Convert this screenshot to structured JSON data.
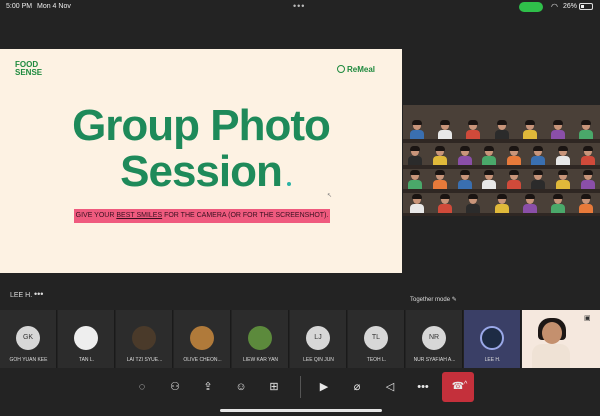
{
  "status_bar": {
    "time": "5:00 PM",
    "date": "Mon 4 Nov",
    "battery": "26%"
  },
  "slide": {
    "logo_left": [
      "FOOD",
      "SENSE"
    ],
    "logo_right": "ReMeal",
    "headline_line1": "Group Photo",
    "headline_line2": "Session",
    "banner_pre": "GIVE YOUR ",
    "banner_emph": "BEST SMILES",
    "banner_post": " FOR THE CAMERA (OR FOR THE SCREENSHOT)."
  },
  "presenter": {
    "label": "LEE H."
  },
  "together_mode": {
    "label": "Together mode"
  },
  "participants": [
    {
      "initials": "GK",
      "name": "GOH YUAN KEE"
    },
    {
      "initials": "",
      "name": "TAN L."
    },
    {
      "initials": "",
      "name": "LAI TZI SYUE..."
    },
    {
      "initials": "",
      "name": "OLIVE CHEON..."
    },
    {
      "initials": "",
      "name": "LIEW KAR YAN"
    },
    {
      "initials": "LJ",
      "name": "LEE QIN JUN"
    },
    {
      "initials": "TL",
      "name": "TEOH L."
    },
    {
      "initials": "NR",
      "name": "NUR SYAFIAH A..."
    },
    {
      "initials": "",
      "name": "LEE H."
    }
  ],
  "colors": {
    "accent_green": "#1e8a5a",
    "banner_pink": "#ef5a7e",
    "hangup_red": "#c4303b",
    "slide_bg": "#fdf2e3"
  },
  "icons": [
    "chat-icon",
    "people-icon",
    "share-icon",
    "reactions-icon",
    "apps-icon",
    "camera-icon",
    "mic-off-icon",
    "speaker-off-icon",
    "more-icon",
    "hangup-icon"
  ]
}
